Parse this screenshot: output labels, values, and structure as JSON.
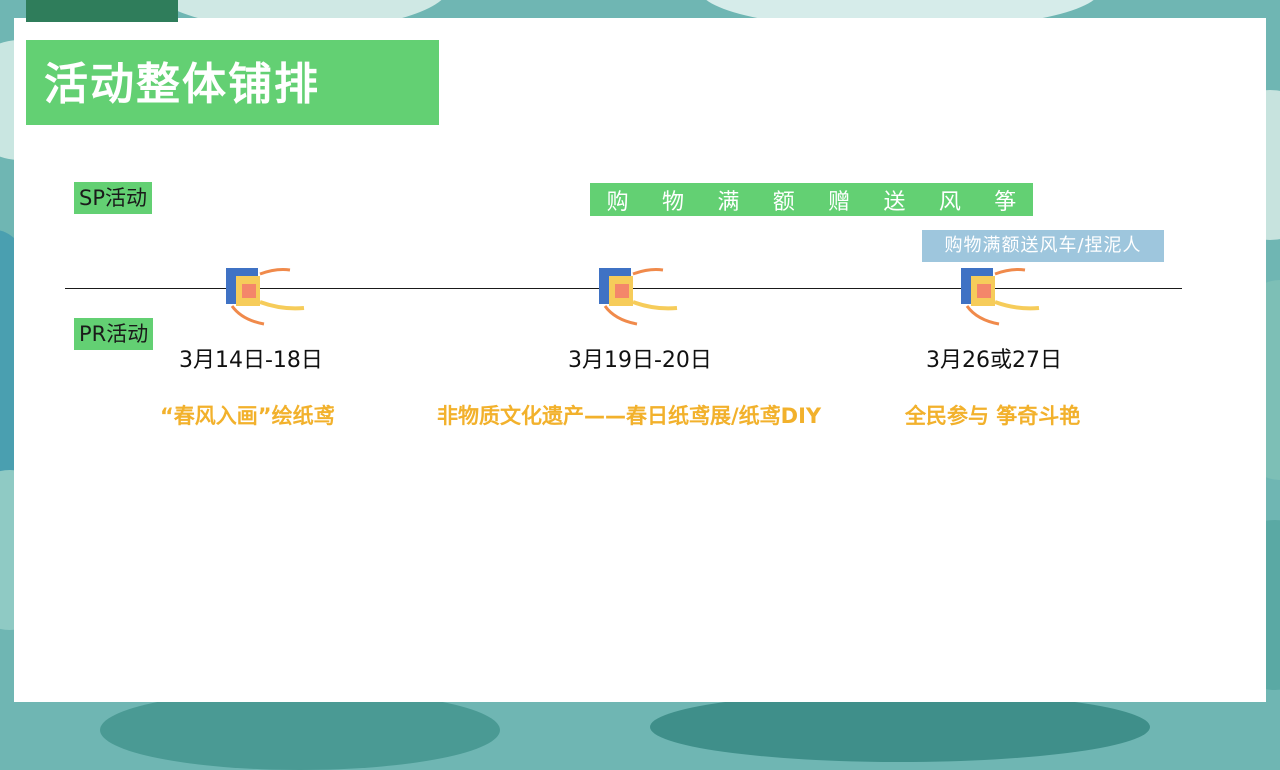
{
  "title": "活动整体铺排",
  "tags": {
    "sp": "SP活动",
    "pr": "PR活动"
  },
  "sp_banner": [
    "购",
    "物",
    "满",
    "额",
    "赠",
    "送",
    "风",
    "筝"
  ],
  "sp_sub_banner": "购物满额送风车/捏泥人",
  "timeline": [
    {
      "date": "3月14日-18日",
      "event": "“春风入画”绘纸鸢"
    },
    {
      "date": "3月19日-20日",
      "event": "非物质文化遗产——春日纸鸢展/纸鸢DIY"
    },
    {
      "date": "3月26或27日",
      "event": "全民参与  筝奇斗艳"
    }
  ],
  "colors": {
    "accent_green": "#63d073",
    "sub_banner_blue": "#9ec6dd",
    "event_gold": "#f2b12c",
    "background_teal": "#6fb6b3"
  },
  "icons": {
    "kite": "kite-icon"
  }
}
